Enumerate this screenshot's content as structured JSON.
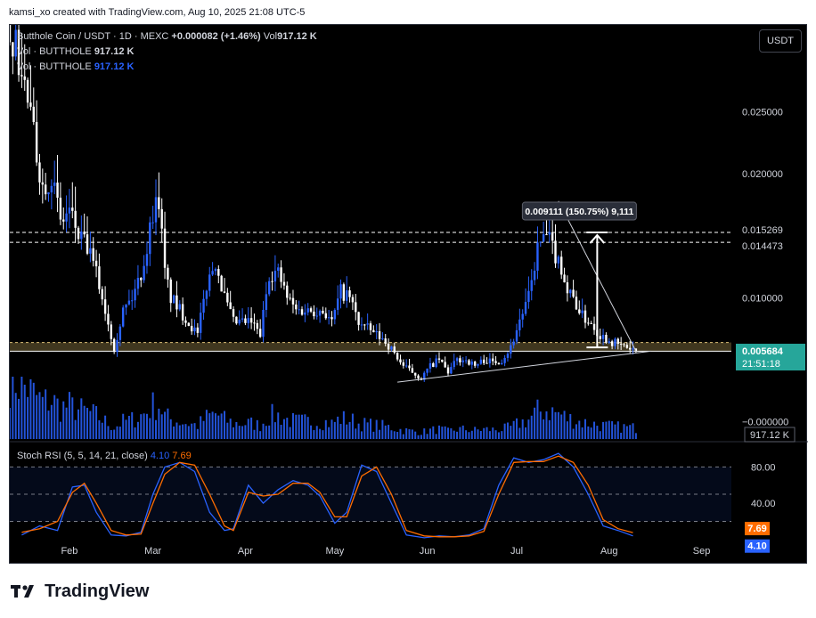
{
  "header": {
    "text": "kamsi_xo created with TradingView.com, Aug 10, 2025 21:08 UTC-5"
  },
  "legend": {
    "symbol": "Butthole Coin / USDT · 1D · MEXC",
    "change": "+0.000082 (+1.46%)",
    "vol_label": "Vol",
    "vol_value": "917.12 K",
    "vol1_label": "Vol · BUTTHOLE",
    "vol1_value": "917.12 K",
    "vol2_label": "Vol · BUTTHOLE",
    "vol2_value": "917.12 K"
  },
  "currency_button": "USDT",
  "footer": {
    "brand": "TradingView"
  },
  "colors": {
    "up": "#2962ff",
    "down": "#ffffff",
    "rsi_k": "#2962ff",
    "rsi_d": "#ff6d00",
    "support_zone": "#8d7b45",
    "price_tag": "#26a69a",
    "volume": "#2962ff"
  },
  "chart_data": [
    {
      "type": "candlestick",
      "price_axis": {
        "ticks": [
          "0.025000",
          "0.020000",
          "0.010000",
          "−0.000000"
        ],
        "tick_values": [
          0.025,
          0.02,
          0.01,
          0.0
        ],
        "ylim": [
          -0.0016,
          0.032
        ]
      },
      "time_axis": {
        "labels": [
          "Feb",
          "Mar",
          "Apr",
          "May",
          "Jun",
          "Jul",
          "Aug",
          "Sep"
        ],
        "label_dates": [
          "2025-02-01",
          "2025-03-01",
          "2025-04-01",
          "2025-05-01",
          "2025-06-01",
          "2025-07-01",
          "2025-08-01",
          "2025-09-01"
        ],
        "xlim": [
          "2025-01-12",
          "2025-09-11"
        ]
      },
      "close_series": {
        "dates": [
          "2025-01-12",
          "2025-01-15",
          "2025-01-18",
          "2025-01-20",
          "2025-01-23",
          "2025-01-26",
          "2025-01-29",
          "2025-02-01",
          "2025-02-04",
          "2025-02-07",
          "2025-02-10",
          "2025-02-13",
          "2025-02-16",
          "2025-02-19",
          "2025-02-22",
          "2025-02-25",
          "2025-02-27",
          "2025-03-01",
          "2025-03-03",
          "2025-03-05",
          "2025-03-07",
          "2025-03-10",
          "2025-03-13",
          "2025-03-16",
          "2025-03-19",
          "2025-03-22",
          "2025-03-25",
          "2025-03-28",
          "2025-03-31",
          "2025-04-03",
          "2025-04-06",
          "2025-04-09",
          "2025-04-12",
          "2025-04-15",
          "2025-04-18",
          "2025-04-21",
          "2025-04-24",
          "2025-04-27",
          "2025-04-30",
          "2025-05-03",
          "2025-05-06",
          "2025-05-09",
          "2025-05-12",
          "2025-05-15",
          "2025-05-18",
          "2025-05-21",
          "2025-05-24",
          "2025-05-27",
          "2025-05-30",
          "2025-06-02",
          "2025-06-05",
          "2025-06-08",
          "2025-06-11",
          "2025-06-14",
          "2025-06-17",
          "2025-06-20",
          "2025-06-23",
          "2025-06-26",
          "2025-06-29",
          "2025-07-02",
          "2025-07-05",
          "2025-07-08",
          "2025-07-11",
          "2025-07-14",
          "2025-07-16",
          "2025-07-18",
          "2025-07-20",
          "2025-07-23",
          "2025-07-26",
          "2025-07-29",
          "2025-08-01",
          "2025-08-04",
          "2025-08-07",
          "2025-08-10"
        ],
        "close": [
          0.032,
          0.029,
          0.026,
          0.023,
          0.019,
          0.02,
          0.016,
          0.017,
          0.015,
          0.014,
          0.012,
          0.009,
          0.006,
          0.009,
          0.01,
          0.012,
          0.014,
          0.017,
          0.018,
          0.012,
          0.01,
          0.009,
          0.008,
          0.007,
          0.011,
          0.013,
          0.01,
          0.008,
          0.008,
          0.008,
          0.007,
          0.012,
          0.012,
          0.01,
          0.009,
          0.009,
          0.009,
          0.009,
          0.008,
          0.0105,
          0.01,
          0.008,
          0.0075,
          0.007,
          0.0065,
          0.0055,
          0.0045,
          0.004,
          0.0035,
          0.0045,
          0.005,
          0.004,
          0.005,
          0.005,
          0.0045,
          0.005,
          0.0048,
          0.005,
          0.006,
          0.0082,
          0.01,
          0.014,
          0.015,
          0.0135,
          0.0125,
          0.0105,
          0.01,
          0.0085,
          0.008,
          0.007,
          0.0066,
          0.0062,
          0.006,
          0.005684
        ]
      },
      "last_price": "0.005684",
      "countdown": "21:51:18",
      "horizontal_levels": [
        {
          "value": 0.015269,
          "label": "0.015269",
          "style": "dashed"
        },
        {
          "value": 0.014473,
          "label": "0.014473",
          "style": "dashed"
        }
      ],
      "support_zone": {
        "from": 0.0057,
        "to": 0.0064
      },
      "target_measure": {
        "text": "0.009111 (150.75%) 9,111",
        "from": 0.006,
        "to": 0.015269,
        "date": "2025-07-28"
      },
      "trendlines": [
        {
          "name": "descending",
          "from": {
            "date": "2025-07-15",
            "value": 0.0178
          },
          "to": {
            "date": "2025-08-10",
            "value": 0.0057
          }
        },
        {
          "name": "ascending",
          "from": {
            "date": "2025-05-22",
            "value": 0.0032
          },
          "to": {
            "date": "2025-08-15",
            "value": 0.0057
          }
        }
      ]
    },
    {
      "type": "bar",
      "name": "Volume",
      "last_value_label": "917.12 K",
      "note": "relative heights only; no printed scale"
    },
    {
      "type": "line",
      "name": "Stoch RSI",
      "title": "Stoch RSI (5, 5, 14, 21, close)",
      "k_value": "4.10",
      "d_value": "7.69",
      "ylim": [
        -5,
        100
      ],
      "ticks": [
        "80.00",
        "40.00"
      ],
      "tick_values": [
        80,
        40
      ],
      "band": [
        20,
        80
      ],
      "midline": 50,
      "series": [
        {
          "name": "K",
          "color": "#2962ff",
          "dates": [
            "2025-01-16",
            "2025-01-22",
            "2025-01-28",
            "2025-02-02",
            "2025-02-06",
            "2025-02-10",
            "2025-02-15",
            "2025-02-20",
            "2025-02-25",
            "2025-03-01",
            "2025-03-05",
            "2025-03-10",
            "2025-03-15",
            "2025-03-20",
            "2025-03-25",
            "2025-03-28",
            "2025-04-02",
            "2025-04-07",
            "2025-04-12",
            "2025-04-17",
            "2025-04-22",
            "2025-04-26",
            "2025-05-01",
            "2025-05-05",
            "2025-05-10",
            "2025-05-15",
            "2025-05-20",
            "2025-05-25",
            "2025-05-31",
            "2025-06-05",
            "2025-06-10",
            "2025-06-15",
            "2025-06-20",
            "2025-06-25",
            "2025-06-30",
            "2025-07-05",
            "2025-07-10",
            "2025-07-15",
            "2025-07-20",
            "2025-07-25",
            "2025-07-30",
            "2025-08-04",
            "2025-08-09"
          ],
          "values": [
            5,
            15,
            10,
            58,
            60,
            30,
            5,
            4,
            8,
            50,
            80,
            85,
            75,
            30,
            10,
            12,
            60,
            40,
            55,
            65,
            60,
            48,
            18,
            30,
            82,
            75,
            40,
            5,
            2,
            4,
            3,
            5,
            12,
            60,
            90,
            85,
            88,
            95,
            80,
            50,
            15,
            10,
            4
          ]
        },
        {
          "name": "D",
          "color": "#ff6d00",
          "dates": [
            "2025-01-16",
            "2025-01-22",
            "2025-01-28",
            "2025-02-02",
            "2025-02-06",
            "2025-02-10",
            "2025-02-15",
            "2025-02-20",
            "2025-02-25",
            "2025-03-01",
            "2025-03-05",
            "2025-03-10",
            "2025-03-15",
            "2025-03-20",
            "2025-03-25",
            "2025-03-28",
            "2025-04-02",
            "2025-04-07",
            "2025-04-12",
            "2025-04-17",
            "2025-04-22",
            "2025-04-26",
            "2025-05-01",
            "2025-05-05",
            "2025-05-10",
            "2025-05-15",
            "2025-05-20",
            "2025-05-25",
            "2025-05-31",
            "2025-06-05",
            "2025-06-10",
            "2025-06-15",
            "2025-06-20",
            "2025-06-25",
            "2025-06-30",
            "2025-07-05",
            "2025-07-10",
            "2025-07-15",
            "2025-07-20",
            "2025-07-25",
            "2025-07-30",
            "2025-08-04",
            "2025-08-09"
          ],
          "values": [
            8,
            12,
            20,
            52,
            62,
            40,
            10,
            5,
            6,
            40,
            72,
            85,
            82,
            50,
            15,
            10,
            52,
            48,
            50,
            62,
            62,
            52,
            25,
            25,
            70,
            80,
            50,
            10,
            4,
            3,
            3,
            4,
            9,
            50,
            85,
            86,
            86,
            92,
            85,
            60,
            22,
            12,
            7.69
          ]
        }
      ]
    }
  ]
}
